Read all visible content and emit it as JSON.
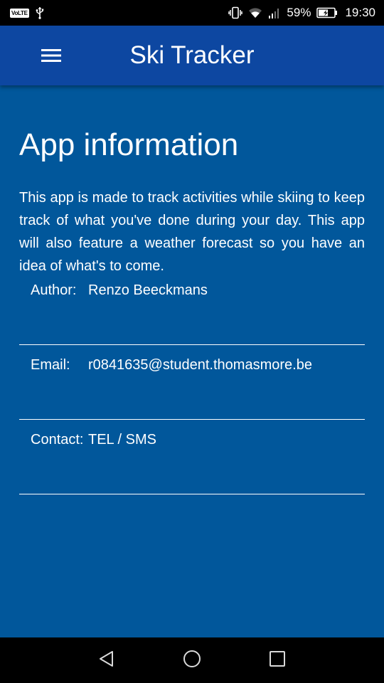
{
  "status_bar": {
    "volte": "VoLTE",
    "battery_percent": "59%",
    "time": "19:30",
    "icons": [
      "volte-icon",
      "usb-icon",
      "vibrate-icon",
      "wifi-icon",
      "signal-icon",
      "battery-icon"
    ]
  },
  "app_bar": {
    "title": "Ski Tracker",
    "menu_icon": "hamburger-menu-icon",
    "background": "#0d47a1"
  },
  "content": {
    "background": "#01579b",
    "heading": "App information",
    "description": "This app is made to track activities while skiing to keep track of what you've done during your day. This app will also feature a weather forecast so you have an idea of what's to come.",
    "rows": [
      {
        "label": "Author:",
        "value": "Renzo Beeckmans"
      },
      {
        "label": "Email:",
        "value": "r0841635@student.thomasmore.be"
      },
      {
        "label": "Contact:",
        "value": "TEL / SMS"
      }
    ]
  },
  "nav_bar": {
    "buttons": [
      "back-icon",
      "home-icon",
      "recents-icon"
    ]
  }
}
